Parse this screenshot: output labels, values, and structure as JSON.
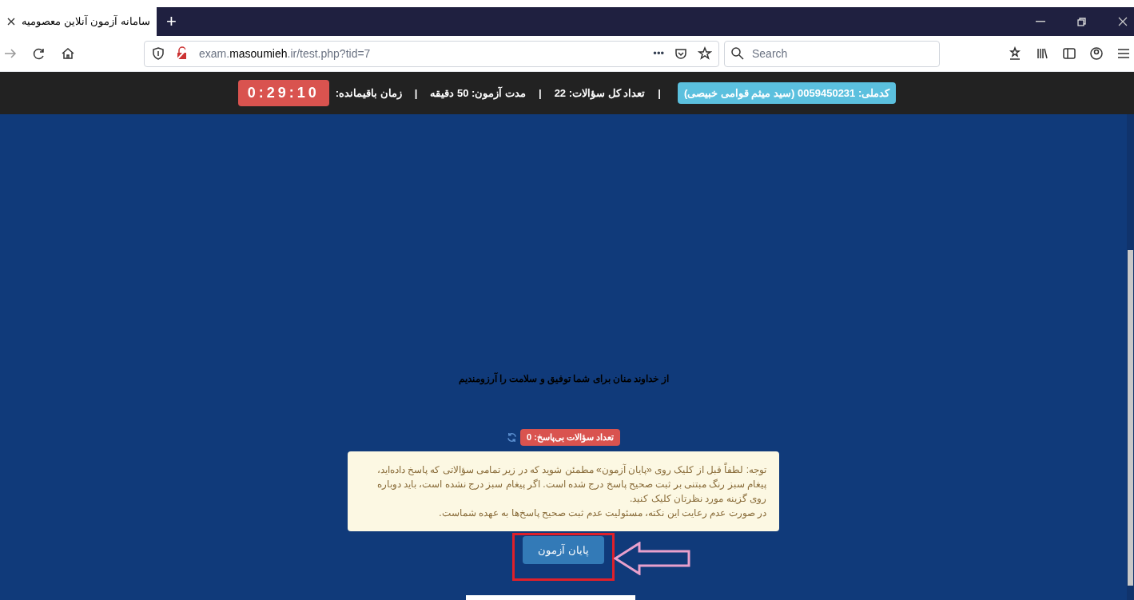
{
  "browser": {
    "tabs": [
      {
        "title": "سامانه آزمون آنلاین معصومیه",
        "selected": true
      }
    ],
    "new_tab": "+",
    "address": {
      "host_pre": "exam.",
      "host": "masoumieh",
      "host_post": ".ir/test.php?tid=7"
    },
    "page_actions": "•••",
    "search": {
      "placeholder": "Search"
    }
  },
  "header": {
    "student": "کدملی: 0059450231 (سید میثم قوامی خبیصی)",
    "items": [
      "تعداد کل سؤالات: 22",
      "مدت آزمون: 50 دقیقه",
      "زمان باقیمانده:"
    ],
    "separator": "|",
    "timer": "0:29:10"
  },
  "content": {
    "greeting": "از خداوند منان برای شما توفیق و سلامت را آرزومندیم",
    "unanswered": "تعداد سؤالات بی‌پاسخ: 0",
    "notice_lines": [
      "توجه: لطفاً قبل از کلیک روی «پایان آزمون» مطمئن شوید که در زیر تمامی سؤالاتی که پاسخ داده‌اید، پیغام سبز رنگ مبتنی بر ثبت صحیح پاسخ درج شده است. اگر پیغام سبز درج نشده است، باید دوباره روی گزینه مورد نظرتان کلیک کنید.",
      "در صورت عدم رعایت این نکته، مسئولیت عدم ثبت صحیح پاسخ‌ها به عهده شماست."
    ],
    "finish_button": "پایان آزمون"
  }
}
